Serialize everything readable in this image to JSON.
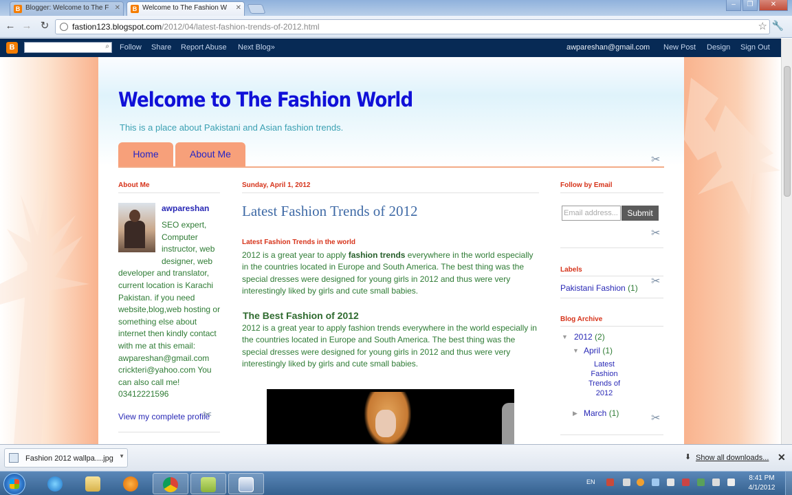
{
  "browser": {
    "tabs": [
      {
        "title": "Blogger: Welcome to The F",
        "active": false
      },
      {
        "title": "Welcome to The Fashion W",
        "active": true
      }
    ],
    "url_host": "fastion123.blogspot.com",
    "url_path": "/2012/04/latest-fashion-trends-of-2012.html"
  },
  "navbar": {
    "search_placeholder": "",
    "links": [
      "Follow",
      "Share",
      "Report Abuse",
      "Next Blog»"
    ],
    "user_email": "awpareshan@gmail.com",
    "right_links": [
      "New Post",
      "Design",
      "Sign Out"
    ]
  },
  "blog": {
    "title": "Welcome to The Fashion World",
    "description": "This is a place about Pakistani and Asian fashion trends.",
    "tabs": [
      "Home",
      "About Me"
    ]
  },
  "about": {
    "heading": "About Me",
    "name": "awpareshan",
    "bio": "SEO expert, Computer instructor, web designer, web developer and translator, current location is Karachi Pakistan. if you need website,blog,web hosting or something else about internet then kindly contact with me at this email: awpareshan@gmail.com crickteri@yahoo.com You can also call me! 03412221596",
    "profile_link": "View my complete profile"
  },
  "post": {
    "date": "Sunday, April 1, 2012",
    "title": "Latest Fashion Trends of 2012",
    "subheading": "Latest Fashion Trends in the world",
    "para1_before": "2012 is a great year to apply ",
    "para1_bold": "fashion trends",
    "para1_after": " everywhere in the world especially in the countries located in Europe and South America. The best thing was the special dresses were designed for young girls in 2012 and thus were very interestingly liked by girls and cute small babies.",
    "heading2": "The Best Fashion of 2012",
    "para2": "2012 is a great year to apply fashion trends everywhere in the world especially in the countries located in Europe and South America. The best thing was the special dresses were designed for young girls in 2012 and thus were very interestingly liked by girls and cute small babies."
  },
  "sidebar": {
    "follow_heading": "Follow by Email",
    "email_placeholder": "Email address...",
    "submit_label": "Submit",
    "labels_heading": "Labels",
    "label_item": "Pakistani Fashion",
    "label_count": "(1)",
    "archive_heading": "Blog Archive",
    "archive": {
      "year": "2012",
      "year_count": "(2)",
      "month": "April",
      "month_count": "(1)",
      "post_lines": [
        "Latest",
        "Fashion",
        "Trends of",
        "2012"
      ],
      "month2": "March",
      "month2_count": "(1)"
    }
  },
  "downloads": {
    "file": "Fashion 2012 wallpa....jpg",
    "show_all": "Show all downloads..."
  },
  "taskbar": {
    "lang": "EN",
    "time": "8:41 PM",
    "date": "4/1/2012"
  },
  "colors": {
    "title_blue": "#1010d8",
    "text_green": "#2e7b34",
    "widget_red": "#d6331a",
    "tab_salmon": "#f7a07a",
    "navbar_navy": "#072a55"
  }
}
